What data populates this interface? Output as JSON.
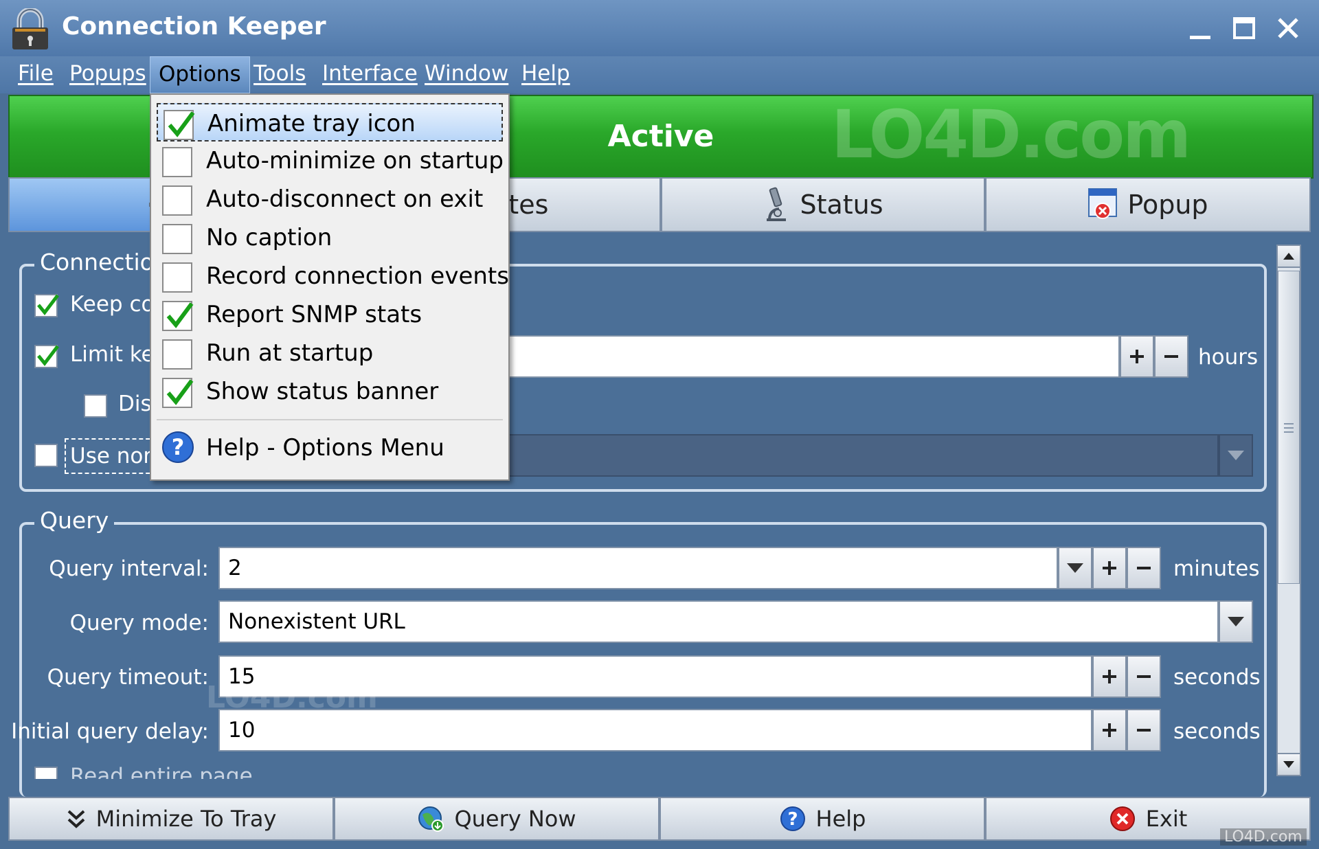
{
  "window": {
    "title": "Connection Keeper"
  },
  "menu": [
    "File",
    "Popups",
    "Options",
    "Tools",
    "Interface",
    "Window",
    "Help"
  ],
  "banner": {
    "status": "Active",
    "watermark": "LO4D.com"
  },
  "tabs": [
    {
      "label": "",
      "icon": "gear-icon"
    },
    {
      "label": "Sites",
      "icon": "globe-icon"
    },
    {
      "label": "Status",
      "icon": "microscope-icon"
    },
    {
      "label": "Popup",
      "icon": "popup-icon"
    }
  ],
  "connection_group": {
    "label": "Connection",
    "keep": "Keep connection alive",
    "limit": "Limit keep-alive",
    "dis": "Disconnect",
    "use": "Use non-default",
    "hours_unit": "hours"
  },
  "query_group": {
    "label": "Query",
    "interval_label": "Query interval:",
    "interval_value": "2",
    "interval_unit": "minutes",
    "mode_label": "Query mode:",
    "mode_value": "Nonexistent URL",
    "timeout_label": "Query timeout:",
    "timeout_value": "15",
    "timeout_unit": "seconds",
    "delay_label": "Initial query delay:",
    "delay_value": "10",
    "delay_unit": "seconds",
    "read_label": "Read entire page"
  },
  "bottom_buttons": [
    "Minimize To Tray",
    "Query Now",
    "Help",
    "Exit"
  ],
  "options_menu": {
    "items": [
      {
        "label": "Animate tray icon",
        "checked": true
      },
      {
        "label": "Auto-minimize on startup",
        "checked": false
      },
      {
        "label": "Auto-disconnect on exit",
        "checked": false
      },
      {
        "label": "No caption",
        "checked": false
      },
      {
        "label": "Record connection events",
        "checked": false
      },
      {
        "label": "Report SNMP stats",
        "checked": true
      },
      {
        "label": "Run at startup",
        "checked": false
      },
      {
        "label": "Show status banner",
        "checked": true
      }
    ],
    "help": "Help - Options Menu"
  },
  "watermark_small": "LO4D.com"
}
